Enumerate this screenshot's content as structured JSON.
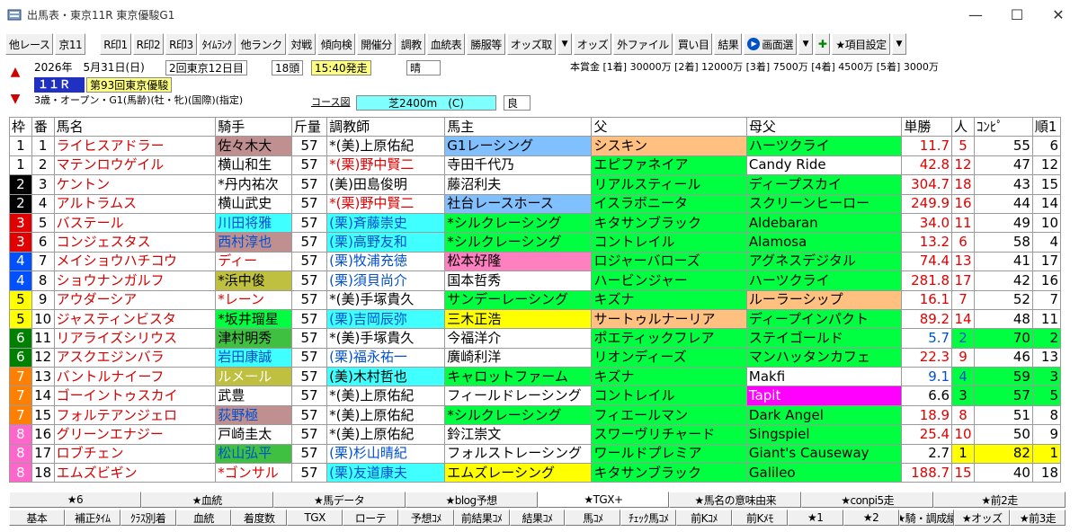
{
  "window": {
    "title": "出馬表・東京11R 東京優駿G1",
    "minimize": "—",
    "maximize": "☐",
    "close": "✕"
  },
  "toolbar": [
    {
      "label": "他レース",
      "gap": false
    },
    {
      "label": "京11",
      "gap": false
    },
    {
      "label": "R印1",
      "gap": true
    },
    {
      "label": "R印2",
      "gap": false
    },
    {
      "label": "R印3",
      "gap": false
    },
    {
      "label": "ﾀｲﾑﾗﾝｸ",
      "gap": false
    },
    {
      "label": "他ランク",
      "gap": false
    },
    {
      "label": "対戦",
      "gap": false
    },
    {
      "label": "傾向検",
      "gap": false
    },
    {
      "label": "開催分",
      "gap": false
    },
    {
      "label": "調教",
      "gap": false
    },
    {
      "label": "血統表",
      "gap": false
    },
    {
      "label": "勝服等",
      "gap": false
    },
    {
      "label": "オッズ取",
      "gap": false
    },
    {
      "label": "▼",
      "gap": false,
      "arrow": true
    },
    {
      "label": "オッズ",
      "gap": false
    },
    {
      "label": "外ファイル",
      "gap": false
    },
    {
      "label": "買い目",
      "gap": false
    },
    {
      "label": "結果",
      "gap": false
    },
    {
      "label": "画面選",
      "gap": false,
      "circle": true
    },
    {
      "label": "▼",
      "gap": false,
      "arrow": true
    },
    {
      "label": "✚",
      "gap": false
    },
    {
      "label": "★項目設定",
      "gap": false
    },
    {
      "label": "▼",
      "gap": false,
      "arrow": true
    }
  ],
  "race": {
    "date": "2026年　5月31日(日)",
    "kai": "2回東京12日目",
    "heads": "18頭",
    "start": "15:40発走",
    "weather": "晴",
    "prize": "本賞金 [1着] 30000万 [2着] 12000万 [3着] 7500万 [4着] 4500万 [5着] 3000万",
    "rno": "１１Ｒ",
    "name": "第93回東京優駿",
    "cond": "3歳・オープン・G1(馬齢)(牡・牝)(国際)(指定)",
    "course_label": "コース図",
    "course": "芝2400m　(C)",
    "baba": "良"
  },
  "headers": [
    "枠",
    "番",
    "馬名",
    "騎手",
    "斤量",
    "調教師",
    "馬主",
    "父",
    "母父",
    "単勝",
    "人",
    "ｺﾝﾋﾟ",
    "順1"
  ],
  "colors": {
    "w1": "#ffffff",
    "w2": "#000000",
    "w3": "#e00000",
    "w4": "#0050ff",
    "w5": "#ffff00",
    "w6": "#008000",
    "w7": "#ff8000",
    "w8": "#ff66cc"
  },
  "rows": [
    {
      "waku": "1",
      "num": "1",
      "name": "ライヒスアドラー",
      "jockey": "佐々木大",
      "wt": "57",
      "mark": "",
      "trainer": "*(美)上原佑紀",
      "owner": "G1レーシング",
      "sire": "シスキン",
      "dam_sire": "ハーツクライ",
      "odds": "11.7",
      "pop": "5",
      "compi": "55",
      "jun": "6"
    },
    {
      "waku": "1",
      "num": "2",
      "name": "マテンロウゲイル",
      "jockey": "横山和生",
      "wt": "57",
      "trainer": "*(栗)野中賢二",
      "owner": "寺田千代乃",
      "sire": "エピファネイア",
      "dam_sire": "Candy Ride",
      "odds": "42.8",
      "pop": "12",
      "compi": "47",
      "jun": "12"
    },
    {
      "waku": "2",
      "num": "3",
      "name": "ケントン",
      "jockey": "*丹内祐次",
      "wt": "57",
      "trainer": "(美)田島俊明",
      "owner": "藤沼利夫",
      "sire": "リアルスティール",
      "dam_sire": "ディープスカイ",
      "odds": "304.7",
      "pop": "18",
      "compi": "43",
      "jun": "15"
    },
    {
      "waku": "2",
      "num": "4",
      "name": "アルトラムス",
      "jockey": "横山武史",
      "wt": "57",
      "trainer": "*(栗)野中賢二",
      "owner": "社台レースホース",
      "sire": "イスラボニータ",
      "dam_sire": "スクリーンヒーロー",
      "odds": "249.9",
      "pop": "16",
      "compi": "44",
      "jun": "14"
    },
    {
      "waku": "3",
      "num": "5",
      "name": "バステール",
      "jockey": "川田将雅",
      "wt": "57",
      "trainer": "(栗)斉藤崇史",
      "owner": "*シルクレーシング",
      "sire": "キタサンブラック",
      "dam_sire": "Aldebaran",
      "odds": "34.0",
      "pop": "11",
      "compi": "49",
      "jun": "10"
    },
    {
      "waku": "3",
      "num": "6",
      "name": "コンジェスタス",
      "jockey": "西村淳也",
      "wt": "57",
      "trainer": "(栗)高野友和",
      "owner": "*シルクレーシング",
      "sire": "コントレイル",
      "dam_sire": "Alamosa",
      "odds": "13.2",
      "pop": "6",
      "compi": "58",
      "jun": "4"
    },
    {
      "waku": "4",
      "num": "7",
      "name": "メイショウハチコウ",
      "jockey": "ディー",
      "wt": "57",
      "trainer": "(栗)牧浦充徳",
      "owner": "松本好隆",
      "sire": "ロジャーバローズ",
      "dam_sire": "アグネスデジタル",
      "odds": "74.4",
      "pop": "13",
      "compi": "41",
      "jun": "17"
    },
    {
      "waku": "4",
      "num": "8",
      "name": "ショウナンガルフ",
      "jockey": "*浜中俊",
      "wt": "57",
      "trainer": "(栗)須貝尚介",
      "owner": "国本哲秀",
      "sire": "ハービンジャー",
      "dam_sire": "ハーツクライ",
      "odds": "281.8",
      "pop": "17",
      "compi": "42",
      "jun": "16"
    },
    {
      "waku": "5",
      "num": "9",
      "name": "アウダーシア",
      "jockey": "*レーン",
      "wt": "57",
      "trainer": "*(美)手塚貴久",
      "owner": "サンデーレーシング",
      "sire": "キズナ",
      "dam_sire": "ルーラーシップ",
      "odds": "16.1",
      "pop": "7",
      "compi": "52",
      "jun": "7"
    },
    {
      "waku": "5",
      "num": "10",
      "name": "ジャスティンビスタ",
      "jockey": "*坂井瑠星",
      "wt": "57",
      "trainer": "(栗)吉岡辰弥",
      "owner": "三木正浩",
      "sire": "サートゥルナーリア",
      "dam_sire": "ディープインパクト",
      "odds": "89.2",
      "pop": "14",
      "compi": "48",
      "jun": "11"
    },
    {
      "waku": "6",
      "num": "11",
      "name": "リアライズシリウス",
      "jockey": "津村明秀",
      "wt": "57",
      "trainer": "*(美)手塚貴久",
      "owner": "今福洋介",
      "sire": "ポエティックフレア",
      "dam_sire": "ステイゴールド",
      "odds": "5.7",
      "pop": "2",
      "compi": "70",
      "jun": "2"
    },
    {
      "waku": "6",
      "num": "12",
      "name": "アスクエジンバラ",
      "jockey": "岩田康誠",
      "wt": "57",
      "trainer": "(栗)福永祐一",
      "owner": "廣崎利洋",
      "sire": "リオンディーズ",
      "dam_sire": "マンハッタンカフェ",
      "odds": "22.3",
      "pop": "9",
      "compi": "46",
      "jun": "13"
    },
    {
      "waku": "7",
      "num": "13",
      "name": "バントルナイーフ",
      "jockey": "ルメール",
      "wt": "57",
      "trainer": "(美)木村哲也",
      "owner": "キャロットファーム",
      "sire": "キズナ",
      "dam_sire": "Makfi",
      "odds": "9.1",
      "pop": "4",
      "compi": "59",
      "jun": "3"
    },
    {
      "waku": "7",
      "num": "14",
      "name": "ゴーイントゥスカイ",
      "jockey": "武豊",
      "wt": "57",
      "trainer": "*(美)上原佑紀",
      "owner": "フィールドレーシング",
      "sire": "コントレイル",
      "dam_sire": "Tapit",
      "odds": "6.6",
      "pop": "3",
      "compi": "57",
      "jun": "5"
    },
    {
      "waku": "7",
      "num": "15",
      "name": "フォルテアンジェロ",
      "jockey": "荻野極",
      "wt": "57",
      "trainer": "*(美)上原佑紀",
      "owner": "*シルクレーシング",
      "sire": "フィエールマン",
      "dam_sire": "Dark Angel",
      "odds": "18.9",
      "pop": "8",
      "compi": "51",
      "jun": "8"
    },
    {
      "waku": "8",
      "num": "16",
      "name": "グリーンエナジー",
      "jockey": "戸崎圭太",
      "wt": "57",
      "trainer": "*(美)上原佑紀",
      "owner": "鈴江崇文",
      "sire": "スワーヴリチャード",
      "dam_sire": "Singspiel",
      "odds": "25.4",
      "pop": "10",
      "compi": "50",
      "jun": "9"
    },
    {
      "waku": "8",
      "num": "17",
      "name": "ロブチェン",
      "jockey": "松山弘平",
      "wt": "57",
      "trainer": "(栗)杉山晴紀",
      "owner": "フォルストレーシング",
      "sire": "ワールドプレミア",
      "dam_sire": "Giant's Causeway",
      "odds": "2.7",
      "pop": "1",
      "compi": "82",
      "jun": "1"
    },
    {
      "waku": "8",
      "num": "18",
      "name": "エムズビギン",
      "jockey": "*ゴンサル",
      "wt": "57",
      "trainer": "(栗)友道康夫",
      "owner": "エムズレーシング",
      "sire": "キタサンブラック",
      "dam_sire": "Galileo",
      "odds": "188.7",
      "pop": "15",
      "compi": "40",
      "jun": "18"
    }
  ],
  "tabs1": [
    "★6",
    "★血統",
    "★馬データ",
    "★blog予想",
    "★TGX+",
    "★馬名の意味由来",
    "★conpi5走",
    "★前2走"
  ],
  "tabs2": [
    "基本",
    "補正ﾀｲﾑ",
    "ｸﾗｽ別着",
    "血統",
    "着度数",
    "TGX",
    "ローテ",
    "予想ｺﾒ",
    "前結果ｺﾒ",
    "結果ｺﾒ",
    "馬ｺﾒ",
    "ﾁｪｯｸ馬ｺﾒ",
    "前Kｺﾒ",
    "前Kﾒﾓ",
    "★1",
    "★2",
    "★騎・調成績",
    "★オッズ",
    "★前3走"
  ]
}
